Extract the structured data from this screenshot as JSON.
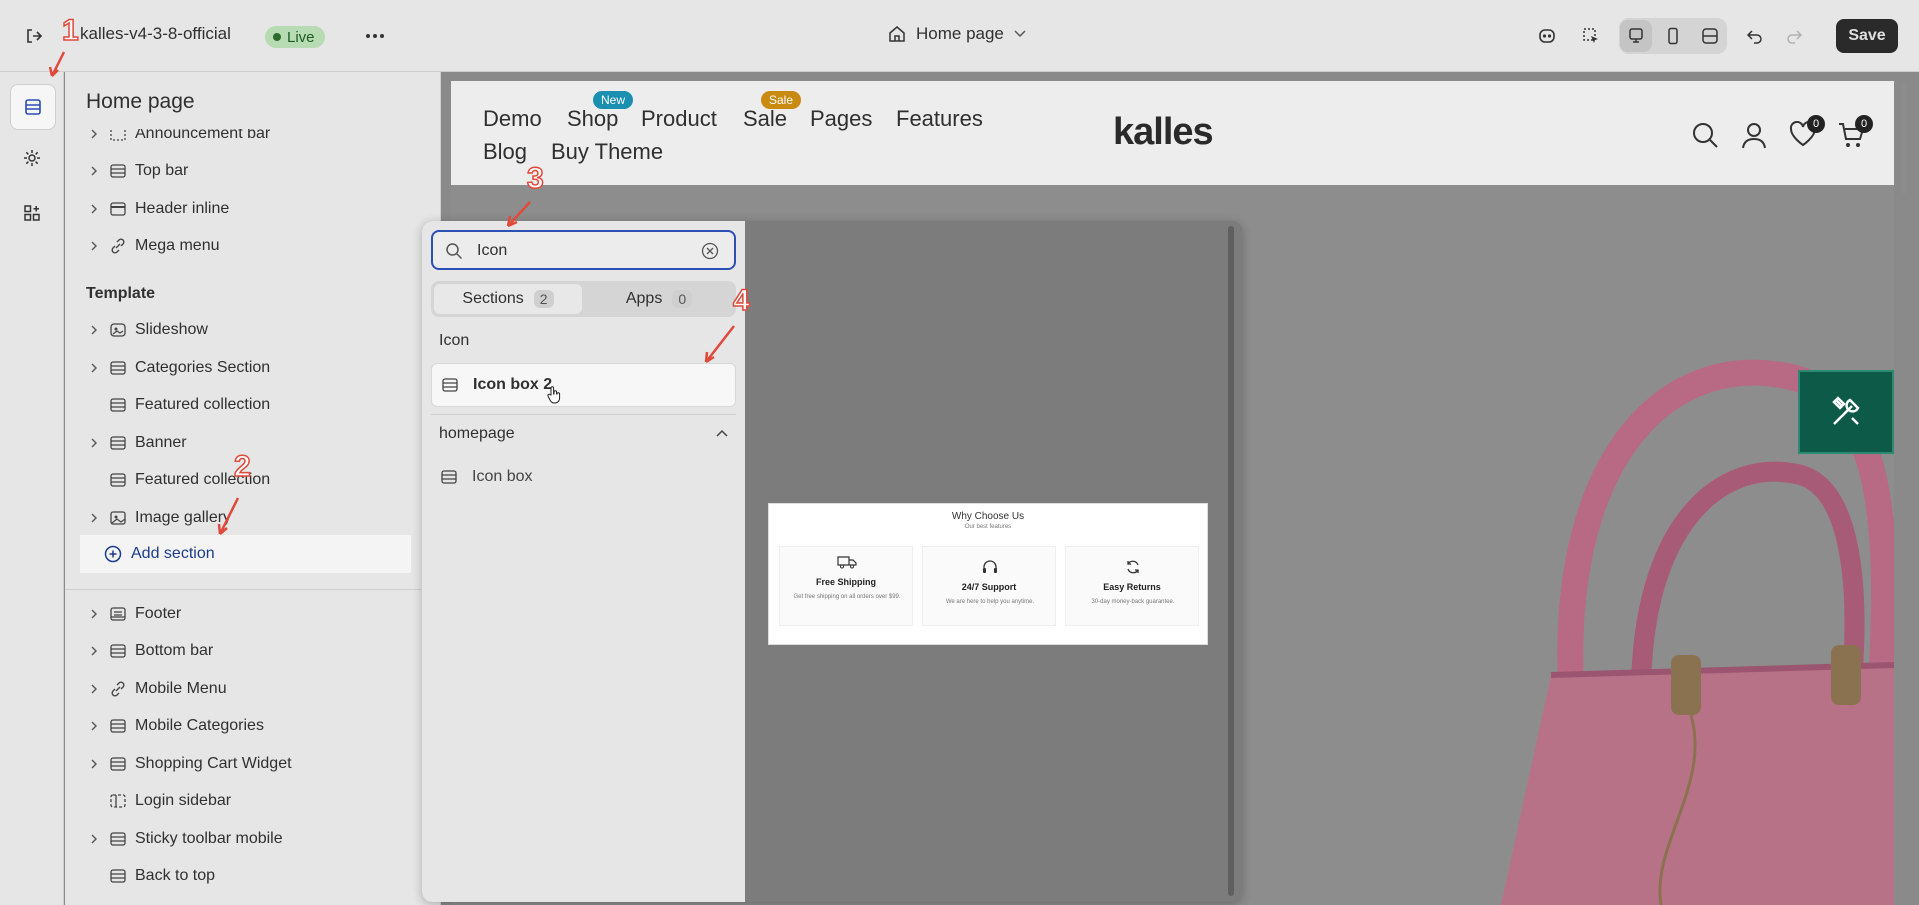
{
  "topbar": {
    "store_name": "kalles-v4-3-8-official",
    "live_badge": "Live",
    "page_select": "Home page",
    "save_label": "Save"
  },
  "sidebar": {
    "title": "Home page",
    "header_items": [
      {
        "label": "Announcement bar"
      },
      {
        "label": "Top bar"
      },
      {
        "label": "Header inline"
      },
      {
        "label": "Mega menu"
      }
    ],
    "template_heading": "Template",
    "template_items": [
      {
        "label": "Slideshow"
      },
      {
        "label": "Categories Section"
      },
      {
        "label": "Featured collection"
      },
      {
        "label": "Banner"
      },
      {
        "label": "Featured collection"
      },
      {
        "label": "Image gallery"
      }
    ],
    "add_section": "Add section",
    "footer_items": [
      {
        "label": "Footer"
      },
      {
        "label": "Bottom bar"
      },
      {
        "label": "Mobile Menu"
      },
      {
        "label": "Mobile Categories"
      },
      {
        "label": "Shopping Cart Widget"
      },
      {
        "label": "Login sidebar"
      },
      {
        "label": "Sticky toolbar mobile"
      },
      {
        "label": "Back to top"
      }
    ]
  },
  "picker": {
    "search_value": "Icon",
    "tabs": [
      {
        "label": "Sections",
        "count": "2"
      },
      {
        "label": "Apps",
        "count": "0"
      }
    ],
    "groups": [
      {
        "heading": "Icon",
        "items": [
          "Icon box 2"
        ]
      },
      {
        "heading": "homepage",
        "items": [
          "Icon box"
        ]
      }
    ],
    "thumbnail": {
      "title": "Why Choose Us",
      "subtitle": "Our best features",
      "cards": [
        {
          "title": "Free Shipping",
          "desc": "Get free shipping on all orders over $99."
        },
        {
          "title": "24/7 Support",
          "desc": "We are here to help you anytime."
        },
        {
          "title": "Easy Returns",
          "desc": "30-day money-back guarantee."
        }
      ]
    }
  },
  "storefront": {
    "nav": [
      "Demo",
      "Shop",
      "Product",
      "Sale",
      "Pages",
      "Features",
      "Blog",
      "Buy Theme"
    ],
    "badge_new": "New",
    "badge_sale": "Sale",
    "logo": "kalles",
    "wishlist_count": "0",
    "cart_count": "0"
  },
  "annotations": [
    "1",
    "2",
    "3",
    "4"
  ],
  "colors": {
    "accent_blue": "#2c4fb5",
    "live_green": "#b7dbb2",
    "badge_new": "#1a8fb0",
    "badge_sale": "#c98a10",
    "annotation_red": "#e04a3a",
    "tool_widget": "#0c5a47"
  }
}
